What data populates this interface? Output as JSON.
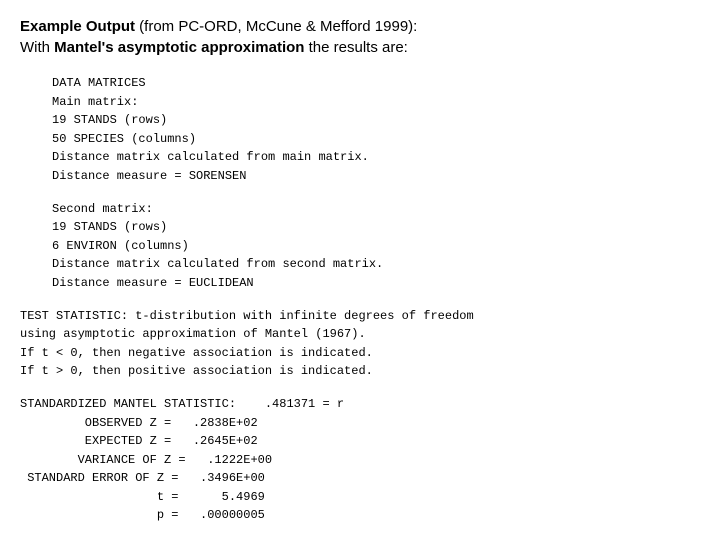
{
  "header": {
    "line1_prefix": "Example Output",
    "line1_rest": " (from PC-ORD, McCune & Mefford 1999):",
    "line2_prefix": "With ",
    "line2_bold": "Mantel's asymptotic approximation",
    "line2_rest": " the results are:"
  },
  "data_matrices": {
    "header": "DATA MATRICES",
    "main_matrix": "Main matrix:",
    "stands": "     19 STANDS   (rows)",
    "species": "     50 SPECIES  (columns)",
    "dist_calc": "Distance matrix calculated from main matrix.",
    "dist_measure": "Distance measure = SORENSEN"
  },
  "second_matrix": {
    "header": "Second matrix:",
    "stands": "     19  STANDS  (rows)",
    "environ": "      6  ENVIRON (columns)",
    "dist_calc": "Distance matrix calculated from second matrix.",
    "dist_measure": "Distance measure = EUCLIDEAN"
  },
  "test_statistic": {
    "line1": "TEST STATISTIC: t-distribution with infinite degrees of freedom",
    "line2": "using asymptotic approximation of Mantel (1967).",
    "line3": "If t < 0, then negative association is indicated.",
    "line4": "If t > 0, then positive association is indicated."
  },
  "standardized": {
    "header": "STANDARDIZED MANTEL STATISTIC:    .481371 = r",
    "observed": "         OBSERVED Z =   .2838E+02",
    "expected": "         EXPECTED Z =   .2645E+02",
    "variance": "        VARIANCE OF Z =   .1222E+00",
    "std_error": " STANDARD ERROR OF Z =   .3496E+00",
    "t_val": "                   t =      5.4969",
    "p_val": "                   p =   .00000005"
  }
}
